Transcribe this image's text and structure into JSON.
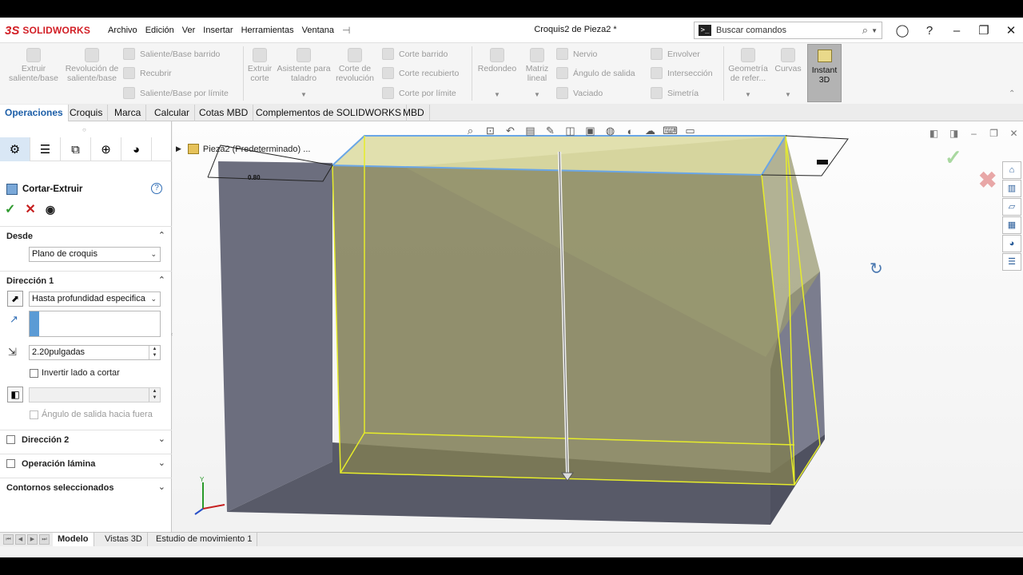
{
  "app": {
    "logo_ds": "3S",
    "logo_text": "SOLIDWORKS",
    "menu": [
      "Archivo",
      "Edición",
      "Ver",
      "Insertar",
      "Herramientas",
      "Ventana"
    ],
    "doc_title": "Croquis2 de Pieza2 *",
    "search_placeholder": "Buscar comandos"
  },
  "commands": {
    "extrude_boss": "Extruir saliente/base",
    "revolve_boss": "Revolución de saliente/base",
    "swept_boss": "Saliente/Base barrido",
    "lofted_boss": "Recubrir",
    "boundary_boss": "Saliente/Base por límite",
    "extruded_cut": "Extruir corte",
    "hole_wizard": "Asistente para taladro",
    "revolved_cut": "Corte de revolución",
    "swept_cut": "Corte barrido",
    "lofted_cut": "Corte recubierto",
    "boundary_cut": "Corte por límite",
    "fillet": "Redondeo",
    "linear_pattern": "Matriz lineal",
    "rib": "Nervio",
    "draft": "Ángulo de salida",
    "shell": "Vaciado",
    "wrap": "Envolver",
    "intersect": "Intersección",
    "mirror": "Simetría",
    "ref_geometry": "Geometría de refer...",
    "curves": "Curvas",
    "instant3d": "Instant 3D"
  },
  "tabs": [
    "Operaciones",
    "Croquis",
    "Marca",
    "Calcular",
    "Cotas MBD",
    "Complementos de SOLIDWORKS",
    "MBD"
  ],
  "panel": {
    "title": "Cortar-Extruir",
    "from_label": "Desde",
    "from_value": "Plano de croquis",
    "dir1_label": "Dirección 1",
    "end_condition": "Hasta profundidad especifica",
    "depth": "2.20pulgadas",
    "flip_side": "Invertir lado a cortar",
    "draft_outward": "Ángulo de salida hacia fuera",
    "dir2_label": "Dirección 2",
    "thin_label": "Operación lámina",
    "contours_label": "Contornos seleccionados"
  },
  "viewport": {
    "tree_item": "Pieza2 (Predeterminado) ...",
    "dim_label": "0.80",
    "axis_y": "Y"
  },
  "bottom_tabs": [
    "Modelo",
    "Vistas 3D",
    "Estudio de movimiento 1"
  ]
}
